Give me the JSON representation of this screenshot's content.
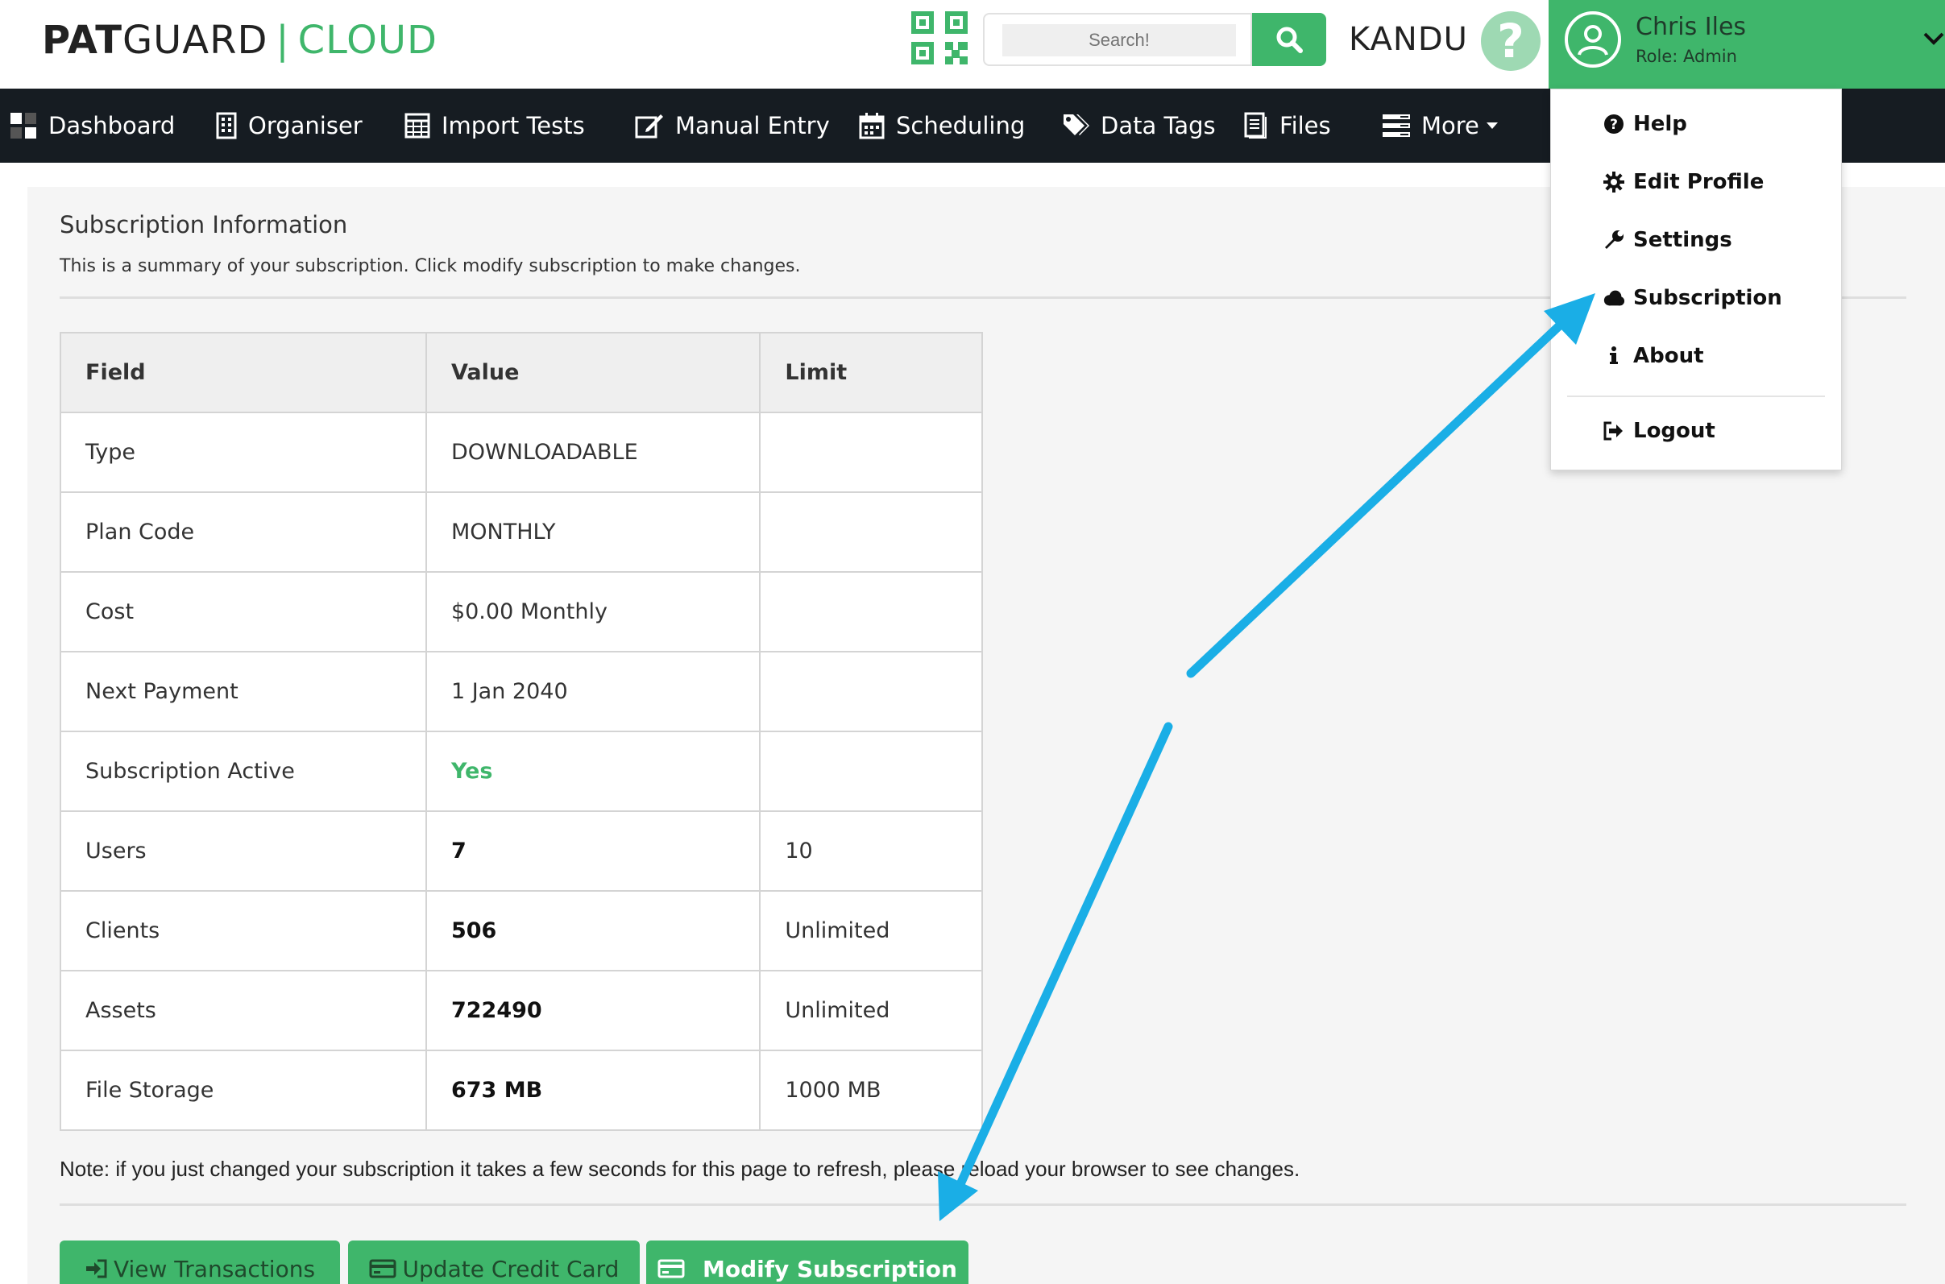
{
  "header": {
    "logo_pat": "PAT",
    "logo_guard": "GUARD",
    "logo_sep": "|",
    "logo_cloud": "CLOUD",
    "search_placeholder": "Search!",
    "org_name": "KANDU",
    "help_glyph": "?",
    "user_name": "Chris Iles",
    "user_role": "Role: Admin"
  },
  "nav": {
    "items": [
      {
        "label": "Dashboard",
        "icon": "dashboard-icon"
      },
      {
        "label": "Organiser",
        "icon": "organiser-icon"
      },
      {
        "label": "Import Tests",
        "icon": "calculator-icon"
      },
      {
        "label": "Manual Entry",
        "icon": "edit-icon"
      },
      {
        "label": "Scheduling",
        "icon": "calendar-icon"
      },
      {
        "label": "Data Tags",
        "icon": "tags-icon"
      },
      {
        "label": "Files",
        "icon": "file-icon"
      },
      {
        "label": "More",
        "icon": "list-icon"
      }
    ]
  },
  "dropdown": {
    "items": [
      {
        "label": "Help",
        "icon": "question-circle-icon"
      },
      {
        "label": "Edit Profile",
        "icon": "gear-icon"
      },
      {
        "label": "Settings",
        "icon": "wrench-icon"
      },
      {
        "label": "Subscription",
        "icon": "cloud-icon"
      },
      {
        "label": "About",
        "icon": "info-icon"
      },
      {
        "label": "Logout",
        "icon": "logout-icon"
      }
    ]
  },
  "content": {
    "title": "Subscription Information",
    "description": "This is a summary of your subscription. Click modify subscription to make changes.",
    "table": {
      "headers": [
        "Field",
        "Value",
        "Limit"
      ],
      "rows": [
        {
          "field": "Type",
          "value": "DOWNLOADABLE",
          "limit": ""
        },
        {
          "field": "Plan Code",
          "value": "MONTHLY",
          "limit": ""
        },
        {
          "field": "Cost",
          "value": "$0.00 Monthly",
          "limit": ""
        },
        {
          "field": "Next Payment",
          "value": "1 Jan 2040",
          "limit": ""
        },
        {
          "field": "Subscription Active",
          "value": "Yes",
          "limit": ""
        },
        {
          "field": "Users",
          "value": "7",
          "limit": "10"
        },
        {
          "field": "Clients",
          "value": "506",
          "limit": "Unlimited"
        },
        {
          "field": "Assets",
          "value": "722490",
          "limit": "Unlimited"
        },
        {
          "field": "File Storage",
          "value": "673 MB",
          "limit": "1000 MB"
        }
      ]
    },
    "note": "Note: if you just changed your subscription it takes a few seconds for this page to refresh, please reload your browser to see changes.",
    "buttons": {
      "view_transactions": "View Transactions",
      "update_credit_card": "Update Credit Card",
      "modify_subscription": "Modify Subscription"
    }
  },
  "colors": {
    "brand_green": "#3fb66b",
    "nav_bg": "#161c22",
    "annotation_arrow": "#1aaee6"
  }
}
